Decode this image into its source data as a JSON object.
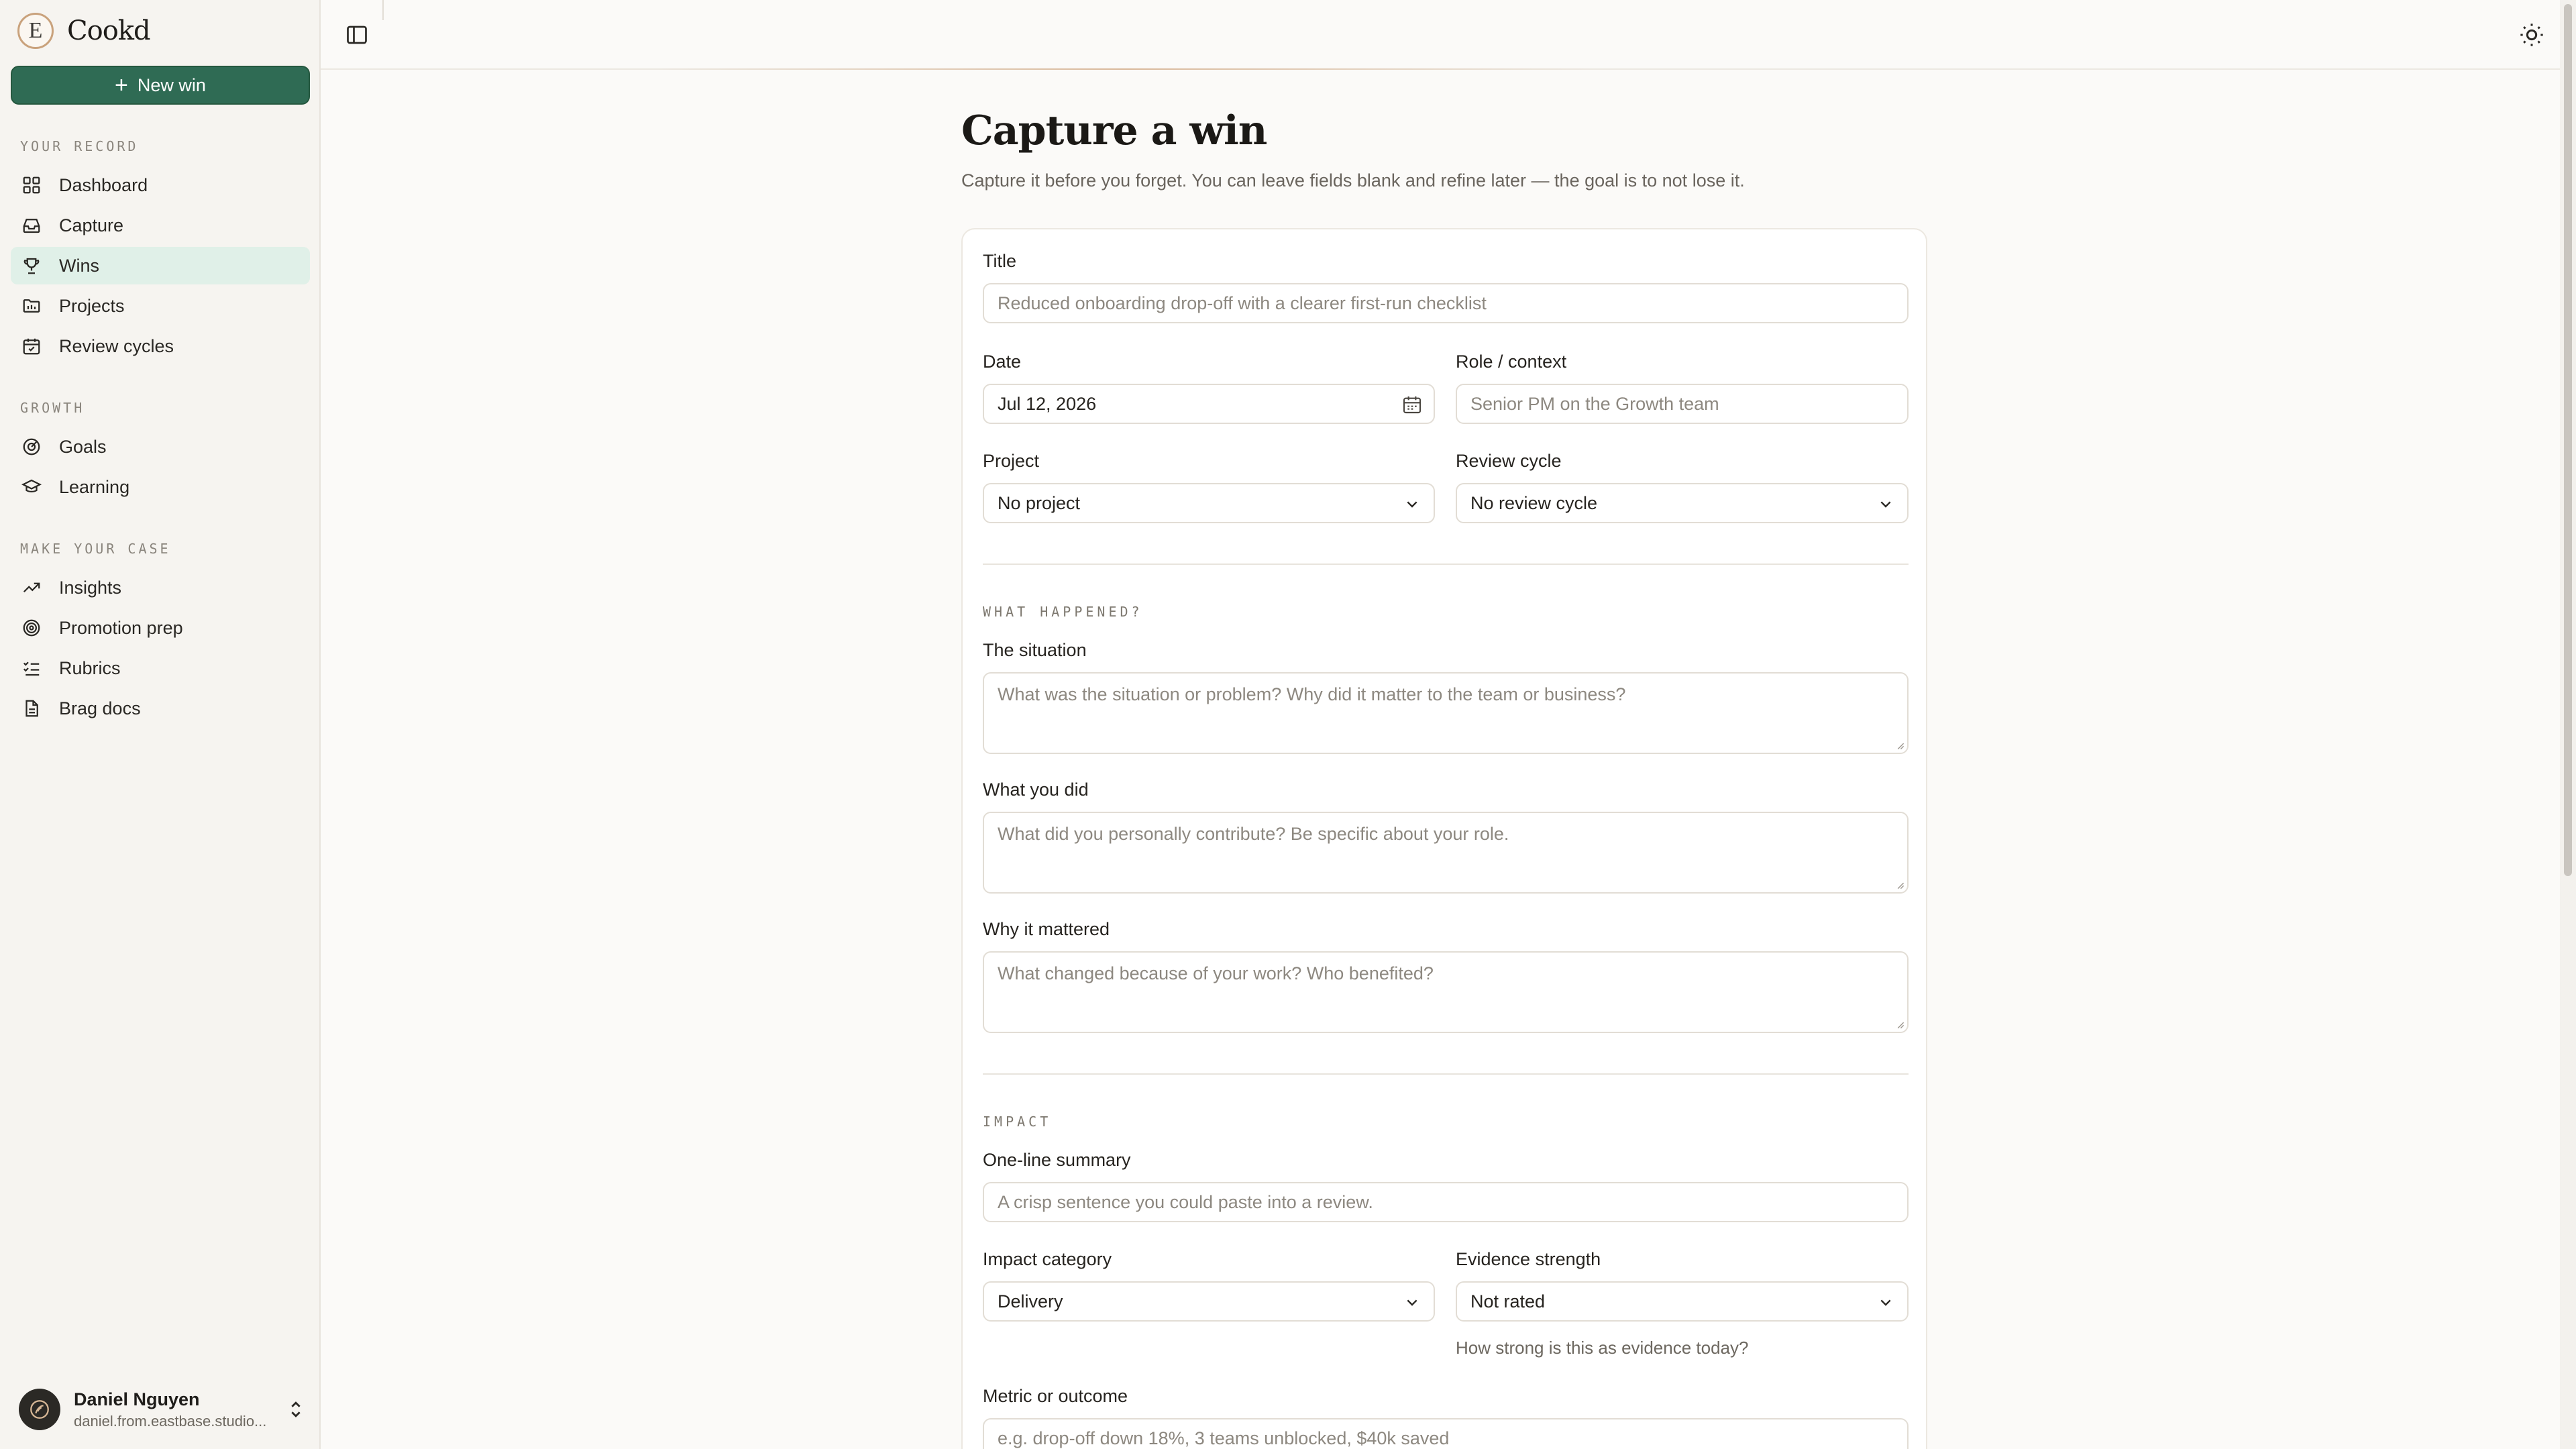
{
  "app": {
    "brand_letter": "E",
    "brand_name": "Cookd",
    "new_win_label": "New win"
  },
  "sidebar": {
    "groups": [
      {
        "label": "YOUR RECORD",
        "items": [
          {
            "label": "Dashboard",
            "icon": "dashboard-icon"
          },
          {
            "label": "Capture",
            "icon": "inbox-icon"
          },
          {
            "label": "Wins",
            "icon": "trophy-icon",
            "active": true
          },
          {
            "label": "Projects",
            "icon": "folder-icon"
          },
          {
            "label": "Review cycles",
            "icon": "calendar-check-icon"
          }
        ]
      },
      {
        "label": "GROWTH",
        "items": [
          {
            "label": "Goals",
            "icon": "target-icon"
          },
          {
            "label": "Learning",
            "icon": "graduation-cap-icon"
          }
        ]
      },
      {
        "label": "MAKE YOUR CASE",
        "items": [
          {
            "label": "Insights",
            "icon": "trending-up-icon"
          },
          {
            "label": "Promotion prep",
            "icon": "bullseye-icon"
          },
          {
            "label": "Rubrics",
            "icon": "checklist-icon"
          },
          {
            "label": "Brag docs",
            "icon": "document-icon"
          }
        ]
      }
    ],
    "user": {
      "name": "Daniel Nguyen",
      "email": "daniel.from.eastbase.studio..."
    }
  },
  "page": {
    "title": "Capture a win",
    "subtitle": "Capture it before you forget. You can leave fields blank and refine later — the goal is to not lose it."
  },
  "form": {
    "title": {
      "label": "Title",
      "placeholder": "Reduced onboarding drop-off with a clearer first-run checklist"
    },
    "date": {
      "label": "Date",
      "value": "Jul 12, 2026"
    },
    "role": {
      "label": "Role / context",
      "placeholder": "Senior PM on the Growth team"
    },
    "project": {
      "label": "Project",
      "value": "No project"
    },
    "review_cycle": {
      "label": "Review cycle",
      "value": "No review cycle"
    },
    "what_happened": {
      "section": "WHAT HAPPENED?",
      "situation": {
        "label": "The situation",
        "placeholder": "What was the situation or problem? Why did it matter to the team or business?"
      },
      "what_you_did": {
        "label": "What you did",
        "placeholder": "What did you personally contribute? Be specific about your role."
      },
      "why_it_mattered": {
        "label": "Why it mattered",
        "placeholder": "What changed because of your work? Who benefited?"
      }
    },
    "impact": {
      "section": "IMPACT",
      "summary": {
        "label": "One-line summary",
        "placeholder": "A crisp sentence you could paste into a review."
      },
      "category": {
        "label": "Impact category",
        "value": "Delivery"
      },
      "evidence": {
        "label": "Evidence strength",
        "value": "Not rated",
        "helper": "How strong is this as evidence today?"
      },
      "metric": {
        "label": "Metric or outcome",
        "placeholder": "e.g. drop-off down 18%, 3 teams unblocked, $40k saved"
      }
    }
  },
  "colors": {
    "accent": "#2f6b54",
    "active_nav_bg": "#e0f0e8",
    "brand_ring": "#c9a27c"
  }
}
